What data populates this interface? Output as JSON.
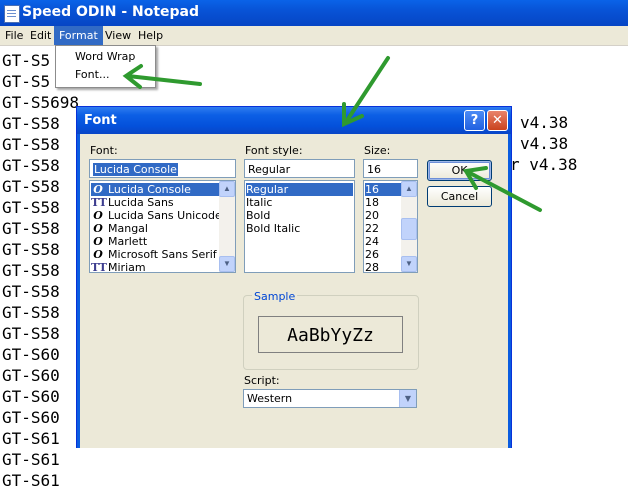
{
  "notepad": {
    "title": "Speed ODIN - Notepad",
    "menu": [
      "File",
      "Edit",
      "Format",
      "View",
      "Help"
    ],
    "lines": [
      "GT-S5",
      "GT-S5",
      "GT-S5698",
      "GT-S58",
      "GT-S58",
      "GT-S58",
      "GT-S58",
      "GT-S58",
      "GT-S58",
      "GT-S58",
      "GT-S58",
      "GT-S58",
      "GT-S58",
      "GT-S58",
      "GT-S60",
      "GT-S60",
      "GT-S60",
      "GT-S60",
      "GT-S61",
      "GT-S61",
      "GT-S61"
    ],
    "right_fragments": [
      "v4.38",
      "v4.38",
      "r v4.38"
    ]
  },
  "format_menu": {
    "items": [
      "Word Wrap",
      "Font..."
    ]
  },
  "font_dialog": {
    "title": "Font",
    "help_button": "?",
    "close_button": "✕",
    "font_label": "Font:",
    "font_value": "Lucida Console",
    "font_list": [
      {
        "name": "Lucida Console",
        "icon": "O"
      },
      {
        "name": "Lucida Sans",
        "icon": "TT"
      },
      {
        "name": "Lucida Sans Unicode",
        "icon": "O"
      },
      {
        "name": "Mangal",
        "icon": "O"
      },
      {
        "name": "Marlett",
        "icon": "O"
      },
      {
        "name": "Microsoft Sans Serif",
        "icon": "O"
      },
      {
        "name": "Miriam",
        "icon": "TT"
      }
    ],
    "style_label": "Font style:",
    "style_value": "Regular",
    "style_list": [
      "Regular",
      "Italic",
      "Bold",
      "Bold Italic"
    ],
    "size_label": "Size:",
    "size_value": "16",
    "size_list": [
      "16",
      "18",
      "20",
      "22",
      "24",
      "26",
      "28"
    ],
    "ok_label": "OK",
    "cancel_label": "Cancel",
    "sample_label": "Sample",
    "sample_text": "AaBbYyZz",
    "script_label": "Script:",
    "script_value": "Western"
  },
  "colors": {
    "arrow": "#2f9a2f",
    "selection": "#316ac5",
    "titlebar": "#0a58dc"
  },
  "icons": [
    "notepad-icon",
    "help-icon",
    "close-icon",
    "scroll-up-icon",
    "scroll-down-icon",
    "dropdown-arrow-icon",
    "annotation-arrow"
  ]
}
